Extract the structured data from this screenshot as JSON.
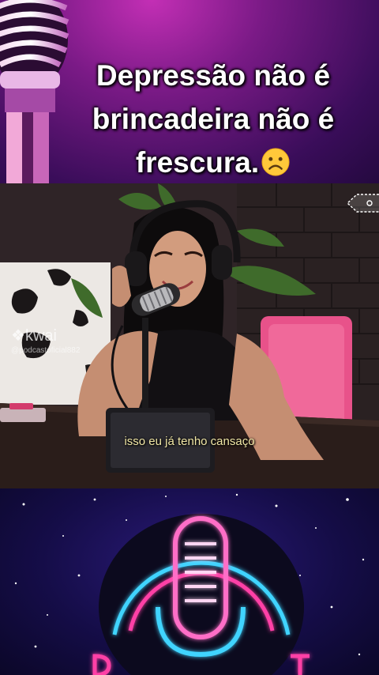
{
  "banner": {
    "caption_line1": "Depressão não é",
    "caption_line2": "brincadeira não é",
    "caption_line3": "frescura.",
    "emoji_icon": "sad-face-emoji"
  },
  "video": {
    "subtitle": "isso eu já tenho cansaço",
    "watermark_brand": "kwai",
    "watermark_handle": "@podcastoficial882"
  },
  "colors": {
    "banner_purple": "#7a1a86",
    "banner_magenta": "#c32fb5",
    "chair_pink": "#e8528a",
    "neon_pink": "#ff3fa6",
    "neon_cyan": "#3fd4ff",
    "night_blue": "#150d48",
    "subtitle_yellow": "#f1e7a6"
  }
}
